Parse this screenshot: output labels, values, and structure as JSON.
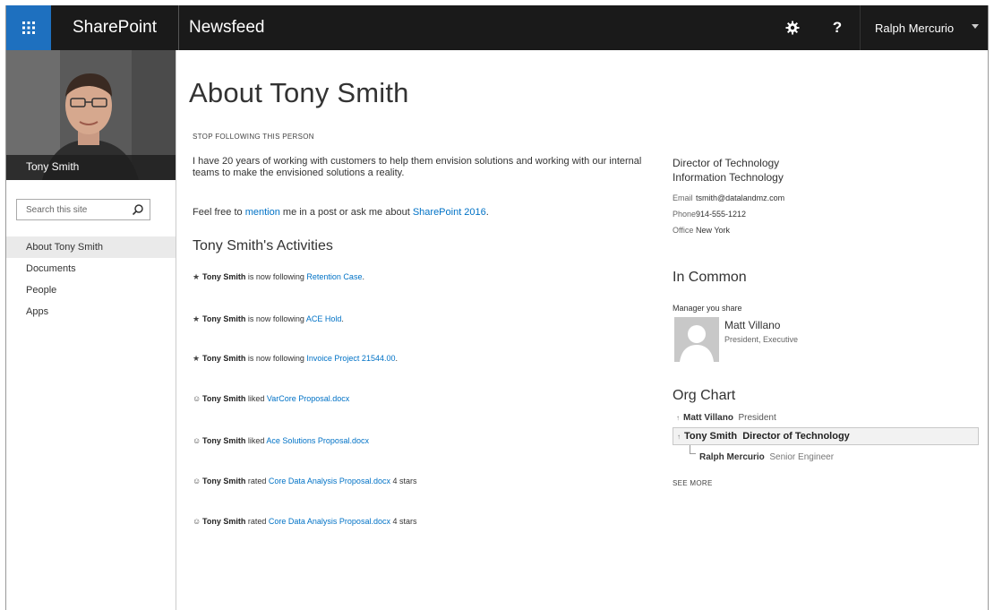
{
  "suitebar": {
    "brand": "SharePoint",
    "app_name": "Newsfeed",
    "help_label": "?",
    "user_name": "Ralph Mercurio"
  },
  "profile": {
    "name": "Tony Smith"
  },
  "search": {
    "placeholder": "Search this site"
  },
  "nav": {
    "items": [
      {
        "label": "About Tony Smith",
        "active": true
      },
      {
        "label": "Documents"
      },
      {
        "label": "People"
      },
      {
        "label": "Apps"
      }
    ]
  },
  "main": {
    "title": "About Tony Smith",
    "stop_following": "STOP FOLLOWING THIS PERSON",
    "bio": "I have 20 years of working with customers to help them envision solutions and working with our internal teams to make the envisioned solutions a reality.",
    "mention_pre": "Feel free to",
    "mention_link": "mention",
    "mention_mid": "me in a post or ask me about",
    "mention_topic": "SharePoint 2016",
    "mention_end": ".",
    "activities_heading": "Tony Smith's Activities",
    "activities": [
      {
        "icon": "star-icon",
        "actor": "Tony Smith",
        "verb": "is now following",
        "target": "Retention Case",
        "suffix": "."
      },
      {
        "icon": "star-icon",
        "actor": "Tony Smith",
        "verb": "is now following",
        "target": "ACE Hold",
        "suffix": "."
      },
      {
        "icon": "star-icon",
        "actor": "Tony Smith",
        "verb": "is now following",
        "target": "Invoice Project 21544.00",
        "suffix": "."
      },
      {
        "icon": "smiley-icon",
        "actor": "Tony Smith",
        "verb": "liked",
        "target": "VarCore Proposal.docx",
        "suffix": ""
      },
      {
        "icon": "smiley-icon",
        "actor": "Tony Smith",
        "verb": "liked",
        "target": "Ace Solutions Proposal.docx",
        "suffix": ""
      },
      {
        "icon": "smiley-icon",
        "actor": "Tony Smith",
        "verb": "rated",
        "target": "Core Data Analysis Proposal.docx",
        "suffix": " 4 stars"
      },
      {
        "icon": "smiley-icon",
        "actor": "Tony Smith",
        "verb": "rated",
        "target": "Core Data Analysis Proposal.docx",
        "suffix": " 4 stars"
      }
    ]
  },
  "contact": {
    "job_title": "Director of Technology",
    "department": "Information Technology",
    "email_label": "Email",
    "email": "tsmith@datalandmz.com",
    "phone_label": "Phone",
    "phone": "914-555-1212",
    "office_label": "Office",
    "office": "New York"
  },
  "in_common": {
    "heading": "In Common",
    "manager_label": "Manager you share",
    "manager_name": "Matt Villano",
    "manager_title": "President, Executive"
  },
  "org_chart": {
    "heading": "Org Chart",
    "manager": {
      "name": "Matt Villano",
      "title": "President"
    },
    "self": {
      "name": "Tony Smith",
      "title": "Director of Technology"
    },
    "report": {
      "name": "Ralph Mercurio",
      "title": "Senior Engineer"
    },
    "see_more": "SEE MORE"
  },
  "colors": {
    "suitebar": "#1a1a1a",
    "waffle": "#1e70bf",
    "link": "#0072c6"
  }
}
